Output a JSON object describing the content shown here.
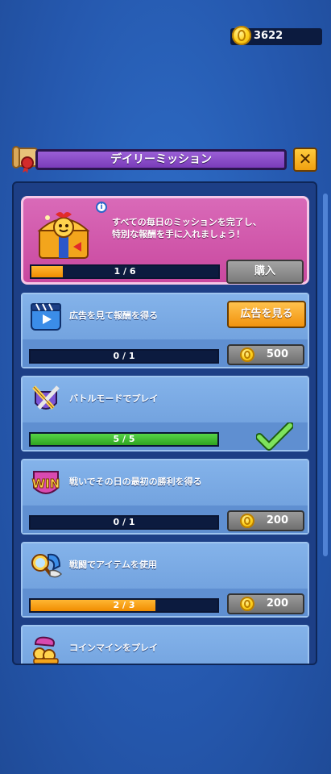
{
  "header": {
    "coins": "3622",
    "title": "デイリーミッション",
    "close_label": "✕"
  },
  "reward": {
    "text_line1": "すべての毎日のミッションを完了し、",
    "text_line2": "特別な報酬を手に入れましょう！",
    "info_label": "i",
    "progress_text": "1 / 6",
    "progress_fraction": 0.17,
    "buy_label": "購入"
  },
  "missions": [
    {
      "title": "広告を見て報酬を得る",
      "icon": "video-ad-icon",
      "action_label": "広告を見る",
      "progress_text": "0 / 1",
      "progress_fraction": 0,
      "reward": "500"
    },
    {
      "title": "バトルモードでプレイ",
      "icon": "crossed-swords-shield-icon",
      "progress_text": "5 / 5",
      "progress_fraction": 1,
      "completed": true
    },
    {
      "title": "戦いでその日の最初の勝利を得る",
      "icon": "win-badge-icon",
      "progress_text": "0 / 1",
      "progress_fraction": 0,
      "reward": "200"
    },
    {
      "title": "戦闘でアイテムを使用",
      "icon": "magnifier-item-icon",
      "progress_text": "2 / 3",
      "progress_fraction": 0.67,
      "reward": "200"
    },
    {
      "title": "コインマインをプレイ",
      "icon": "coin-mine-icon"
    }
  ],
  "colors": {
    "background": "#2558ae",
    "title_purple": "#7a3cba",
    "reward_pink": "#c9489f",
    "progress_orange": "#f08c00",
    "progress_green": "#2fa321",
    "accent_yellow": "#ffc24d"
  }
}
